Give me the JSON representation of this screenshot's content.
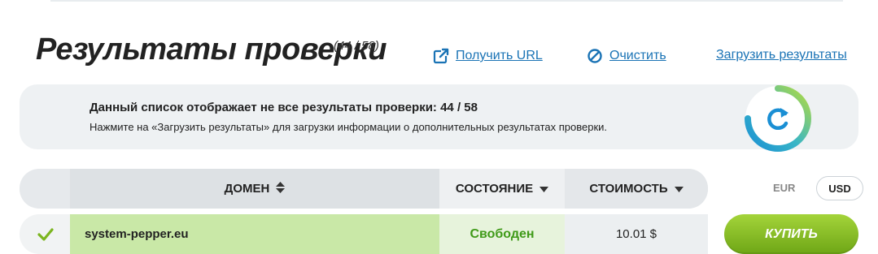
{
  "header": {
    "title": "Результаты проверки",
    "count": "(44 / 58)",
    "actions": {
      "get_url": "Получить URL",
      "clear": "Очистить",
      "load_results": "Загрузить результаты"
    }
  },
  "notice": {
    "title": "Данный список отображает не все результаты проверки: 44 / 58",
    "text": "Нажмите на «Загрузить результаты» для загрузки информации о дополнительных результатах проверки."
  },
  "table": {
    "columns": {
      "domain": "ДОМЕН",
      "state": "СОСТОЯНИЕ",
      "cost": "СТОИМОСТЬ"
    },
    "currency": {
      "eur": "EUR",
      "usd": "USD",
      "selected": "USD"
    },
    "rows": [
      {
        "domain": "system-pepper.eu",
        "state": "Свободен",
        "cost": "10.01 $",
        "buy_label": "КУПИТЬ"
      }
    ]
  },
  "colors": {
    "link": "#1a73b5",
    "available": "#3f9a18",
    "buy_button": "#8cc22a",
    "row_highlight": "#c9e8a7"
  }
}
